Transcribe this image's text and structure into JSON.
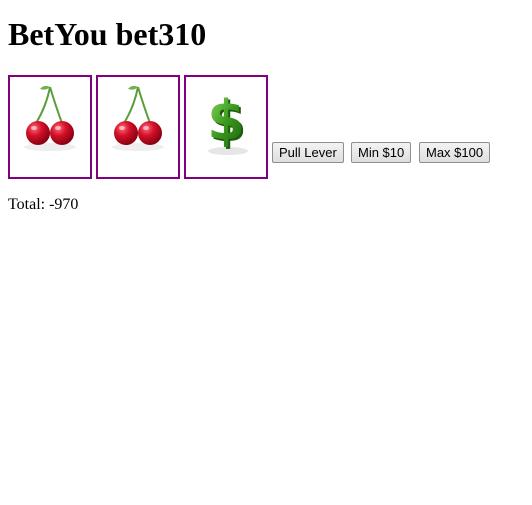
{
  "title": "BetYou bet310",
  "reels": [
    {
      "symbol": "cherry-icon"
    },
    {
      "symbol": "cherry-icon"
    },
    {
      "symbol": "dollar-icon"
    }
  ],
  "buttons": {
    "pull_lever": "Pull Lever",
    "min_bet": "Min $10",
    "max_bet": "Max $100"
  },
  "total": {
    "label": "Total:",
    "value": "-970"
  },
  "colors": {
    "reel_border": "#800080",
    "cherry": "#c8102e",
    "stem": "#5a9e3a",
    "dollar": "#3a9a1f"
  }
}
